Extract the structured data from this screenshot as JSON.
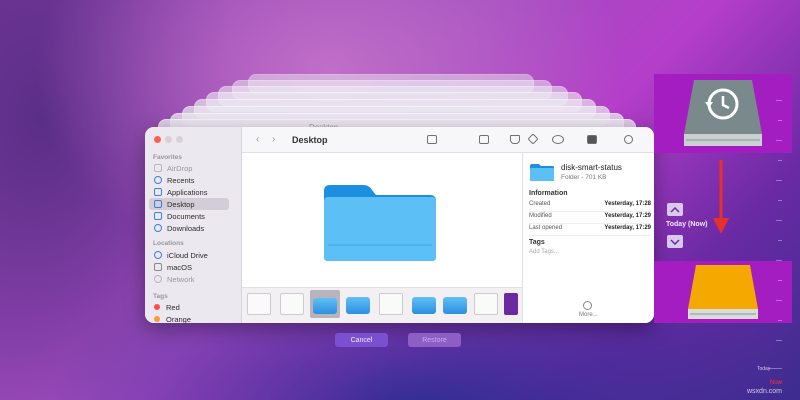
{
  "background_colors": {
    "top": "#b53ec9",
    "bottom": "#2b2d8f"
  },
  "finder": {
    "title": "Desktop",
    "behind_title": "Desktop",
    "sidebar": {
      "favorites_heading": "Favorites",
      "favorites": [
        {
          "label": "AirDrop",
          "icon": "airdrop-icon",
          "dim": true
        },
        {
          "label": "Recents",
          "icon": "clock-icon"
        },
        {
          "label": "Applications",
          "icon": "applications-icon"
        },
        {
          "label": "Desktop",
          "icon": "desktop-icon",
          "selected": true
        },
        {
          "label": "Documents",
          "icon": "document-icon"
        },
        {
          "label": "Downloads",
          "icon": "download-icon"
        }
      ],
      "locations_heading": "Locations",
      "locations": [
        {
          "label": "iCloud Drive",
          "icon": "cloud-icon"
        },
        {
          "label": "macOS",
          "icon": "disk-icon"
        },
        {
          "label": "Network",
          "icon": "globe-icon",
          "dim": true
        }
      ],
      "tags_heading": "Tags",
      "tags": [
        {
          "label": "Red",
          "color": "#ff4d4d"
        },
        {
          "label": "Orange",
          "color": "#ff9a2e"
        }
      ]
    },
    "inspector": {
      "name": "disk-smart-status",
      "kind_size": "Folder - 701 KB",
      "information_heading": "Information",
      "rows": [
        {
          "label": "Created",
          "value": "Yesterday, 17:28"
        },
        {
          "label": "Modified",
          "value": "Yesterday, 17:29"
        },
        {
          "label": "Last opened",
          "value": "Yesterday, 17:29"
        }
      ],
      "tags_heading": "Tags",
      "tags_placeholder": "Add Tags...",
      "more_label": "More..."
    }
  },
  "buttons": {
    "cancel": "Cancel",
    "restore": "Restore"
  },
  "time_machine": {
    "today_label": "Today (Now)",
    "timeline_today": "Today",
    "timeline_now": "Now"
  },
  "drives": {
    "time_machine_color": "#7a8a8c",
    "external_color": "#f5a800",
    "panel_color": "#a31dc0",
    "arrow_color": "#e8302a"
  },
  "watermark": "wsxdn.com"
}
